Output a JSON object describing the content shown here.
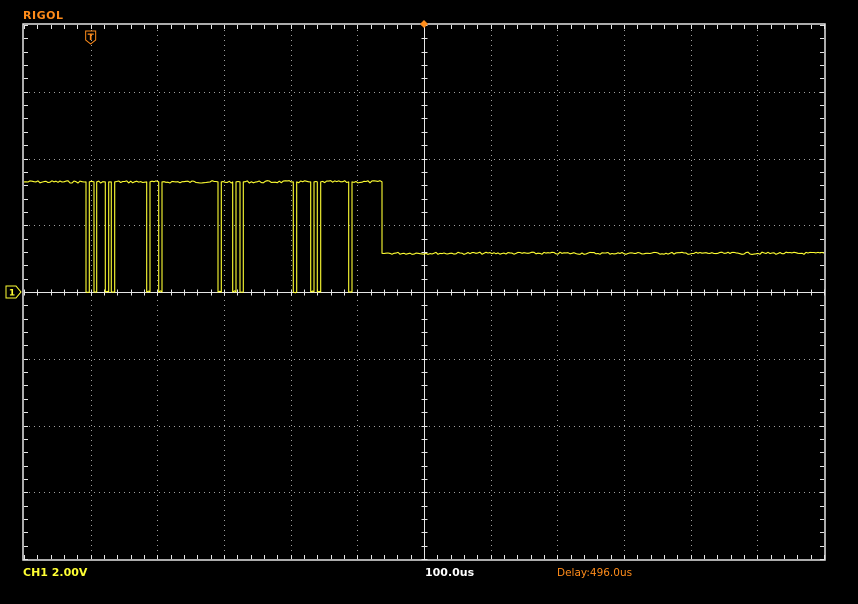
{
  "header": {
    "brand": "RIGOL"
  },
  "status_bar": {
    "channel_scale": "CH1 2.00V",
    "timebase": "100.0us",
    "delay": "Delay:496.0us"
  },
  "markers": {
    "trigger_label": "T",
    "ground_label": "1"
  },
  "colors": {
    "background": "#000000",
    "trace": "#ffff33",
    "grid": "#a0a0a0",
    "accent": "#ff8c1a",
    "text": "#ffffff"
  },
  "icons": {
    "trigger_marker": "trigger-position-icon",
    "ground_marker": "channel-ground-icon",
    "center_marker": "center-delay-icon"
  },
  "waveform": {
    "units": {
      "x": "divisions from left edge",
      "y": "divisions from top edge"
    },
    "divisions": {
      "horizontal": 12,
      "vertical": 8
    },
    "channel_ground_div": 4,
    "trigger_position_div": 1,
    "high_level_div": 2.35,
    "low_level_div": 4.0,
    "settled_level_div": 3.42,
    "transitions_div": [
      0.0,
      0.93,
      0.98,
      1.05,
      1.09,
      1.22,
      1.27,
      1.31,
      1.36,
      1.84,
      1.89,
      2.02,
      2.07,
      2.91,
      2.96,
      3.13,
      3.18,
      3.24,
      3.29,
      4.04,
      4.09,
      4.3,
      4.35,
      4.4,
      4.45,
      4.87,
      4.92,
      5.37
    ]
  }
}
